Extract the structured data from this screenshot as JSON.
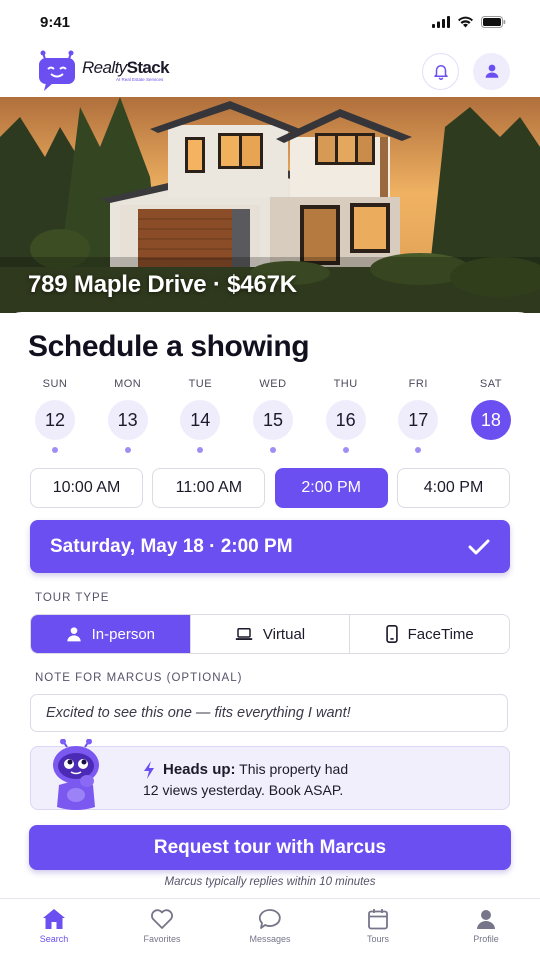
{
  "status_bar": {
    "time": "9:41"
  },
  "header": {
    "logo_word_italic": "Realty",
    "logo_word_bold": "Stack",
    "logo_subtitle": "AI Real Estate Services",
    "icons": [
      "bell-icon",
      "user-icon"
    ]
  },
  "hero": {
    "title": "789 Maple Drive · $467K"
  },
  "schedule": {
    "title": "Schedule a showing",
    "days": [
      {
        "name": "SUN",
        "num": "12"
      },
      {
        "name": "MON",
        "num": "13"
      },
      {
        "name": "TUE",
        "num": "14"
      },
      {
        "name": "WED",
        "num": "15"
      },
      {
        "name": "THU",
        "num": "16"
      },
      {
        "name": "FRI",
        "num": "17"
      },
      {
        "name": "SAT",
        "num": "18"
      }
    ],
    "selected_day": "18",
    "times": [
      "10:00 AM",
      "11:00 AM",
      "2:00 PM",
      "4:00 PM"
    ],
    "selected_time": "2:00 PM",
    "confirmation": "Saturday, May 18 · 2:00 PM"
  },
  "tour_type": {
    "label": "TOUR TYPE",
    "options": [
      "In-person",
      "Virtual",
      "FaceTime"
    ],
    "selected": "In-person"
  },
  "note": {
    "label": "NOTE FOR MARCUS (OPTIONAL)",
    "value": "Excited to see this one — fits everything I want!"
  },
  "heads_up": {
    "title": "Heads up:",
    "line1": "This property had",
    "line2": "12 views yesterday. Book ASAP."
  },
  "cta": {
    "label": "Request tour with Marcus",
    "reply_note": "Marcus typically replies within 10 minutes"
  },
  "tabs": [
    {
      "label": "Search",
      "icon": "home-icon",
      "active": true
    },
    {
      "label": "Favorites",
      "icon": "heart-icon",
      "active": false
    },
    {
      "label": "Messages",
      "icon": "chat-icon",
      "active": false
    },
    {
      "label": "Tours",
      "icon": "calendar-icon",
      "active": false
    },
    {
      "label": "Profile",
      "icon": "user-icon",
      "active": false
    }
  ],
  "colors": {
    "accent": "#6b4ff0",
    "accent_light": "#efedfb",
    "text": "#1c1a2b"
  }
}
